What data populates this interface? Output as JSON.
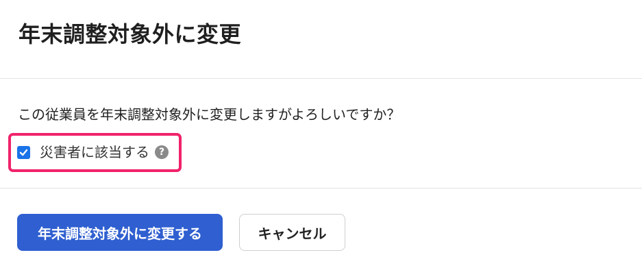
{
  "dialog": {
    "title": "年末調整対象外に変更",
    "message": "この従業員を年末調整対象外に変更しますがよろしいですか？",
    "checkbox": {
      "label": "災害者に該当する",
      "checked": true,
      "help_icon": "question-circle-icon",
      "help_glyph": "?"
    },
    "highlight_color": "#f0226a",
    "buttons": {
      "confirm_label": "年末調整対象外に変更する",
      "cancel_label": "キャンセル"
    },
    "colors": {
      "primary": "#2f5fd0",
      "checkbox": "#1a73e8"
    }
  }
}
